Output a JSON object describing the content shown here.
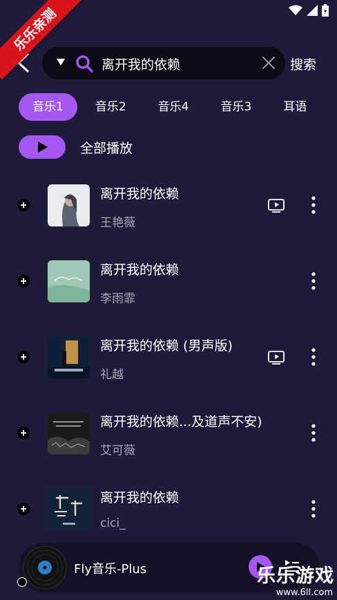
{
  "watermark_ribbon": "乐乐亲测",
  "header": {
    "search_value": "离开我的依赖",
    "search_button": "搜索"
  },
  "tabs": [
    {
      "label": "音乐1",
      "active": true
    },
    {
      "label": "音乐2",
      "active": false
    },
    {
      "label": "音乐4",
      "active": false
    },
    {
      "label": "音乐3",
      "active": false
    },
    {
      "label": "耳语",
      "active": false
    }
  ],
  "play_all": {
    "label": "全部播放"
  },
  "songs": [
    {
      "title": "离开我的依赖",
      "artist": "王艳薇",
      "has_mv": true
    },
    {
      "title": "离开我的依赖",
      "artist": "李雨霏",
      "has_mv": false
    },
    {
      "title": "离开我的依赖 (男声版)",
      "artist": "礼越",
      "has_mv": true
    },
    {
      "title": "离开我的依赖...及道声不安)",
      "artist": "艾可薇",
      "has_mv": false
    },
    {
      "title": "离开我的依赖",
      "artist": "cici_",
      "has_mv": false
    }
  ],
  "player": {
    "title": "Fly音乐-Plus"
  },
  "watermark": {
    "title": "乐乐游戏",
    "url": "www.6ll.com"
  },
  "colors": {
    "background": "#1e1a3a",
    "accent": "#a558f0",
    "search_bg": "#0b0a16"
  }
}
